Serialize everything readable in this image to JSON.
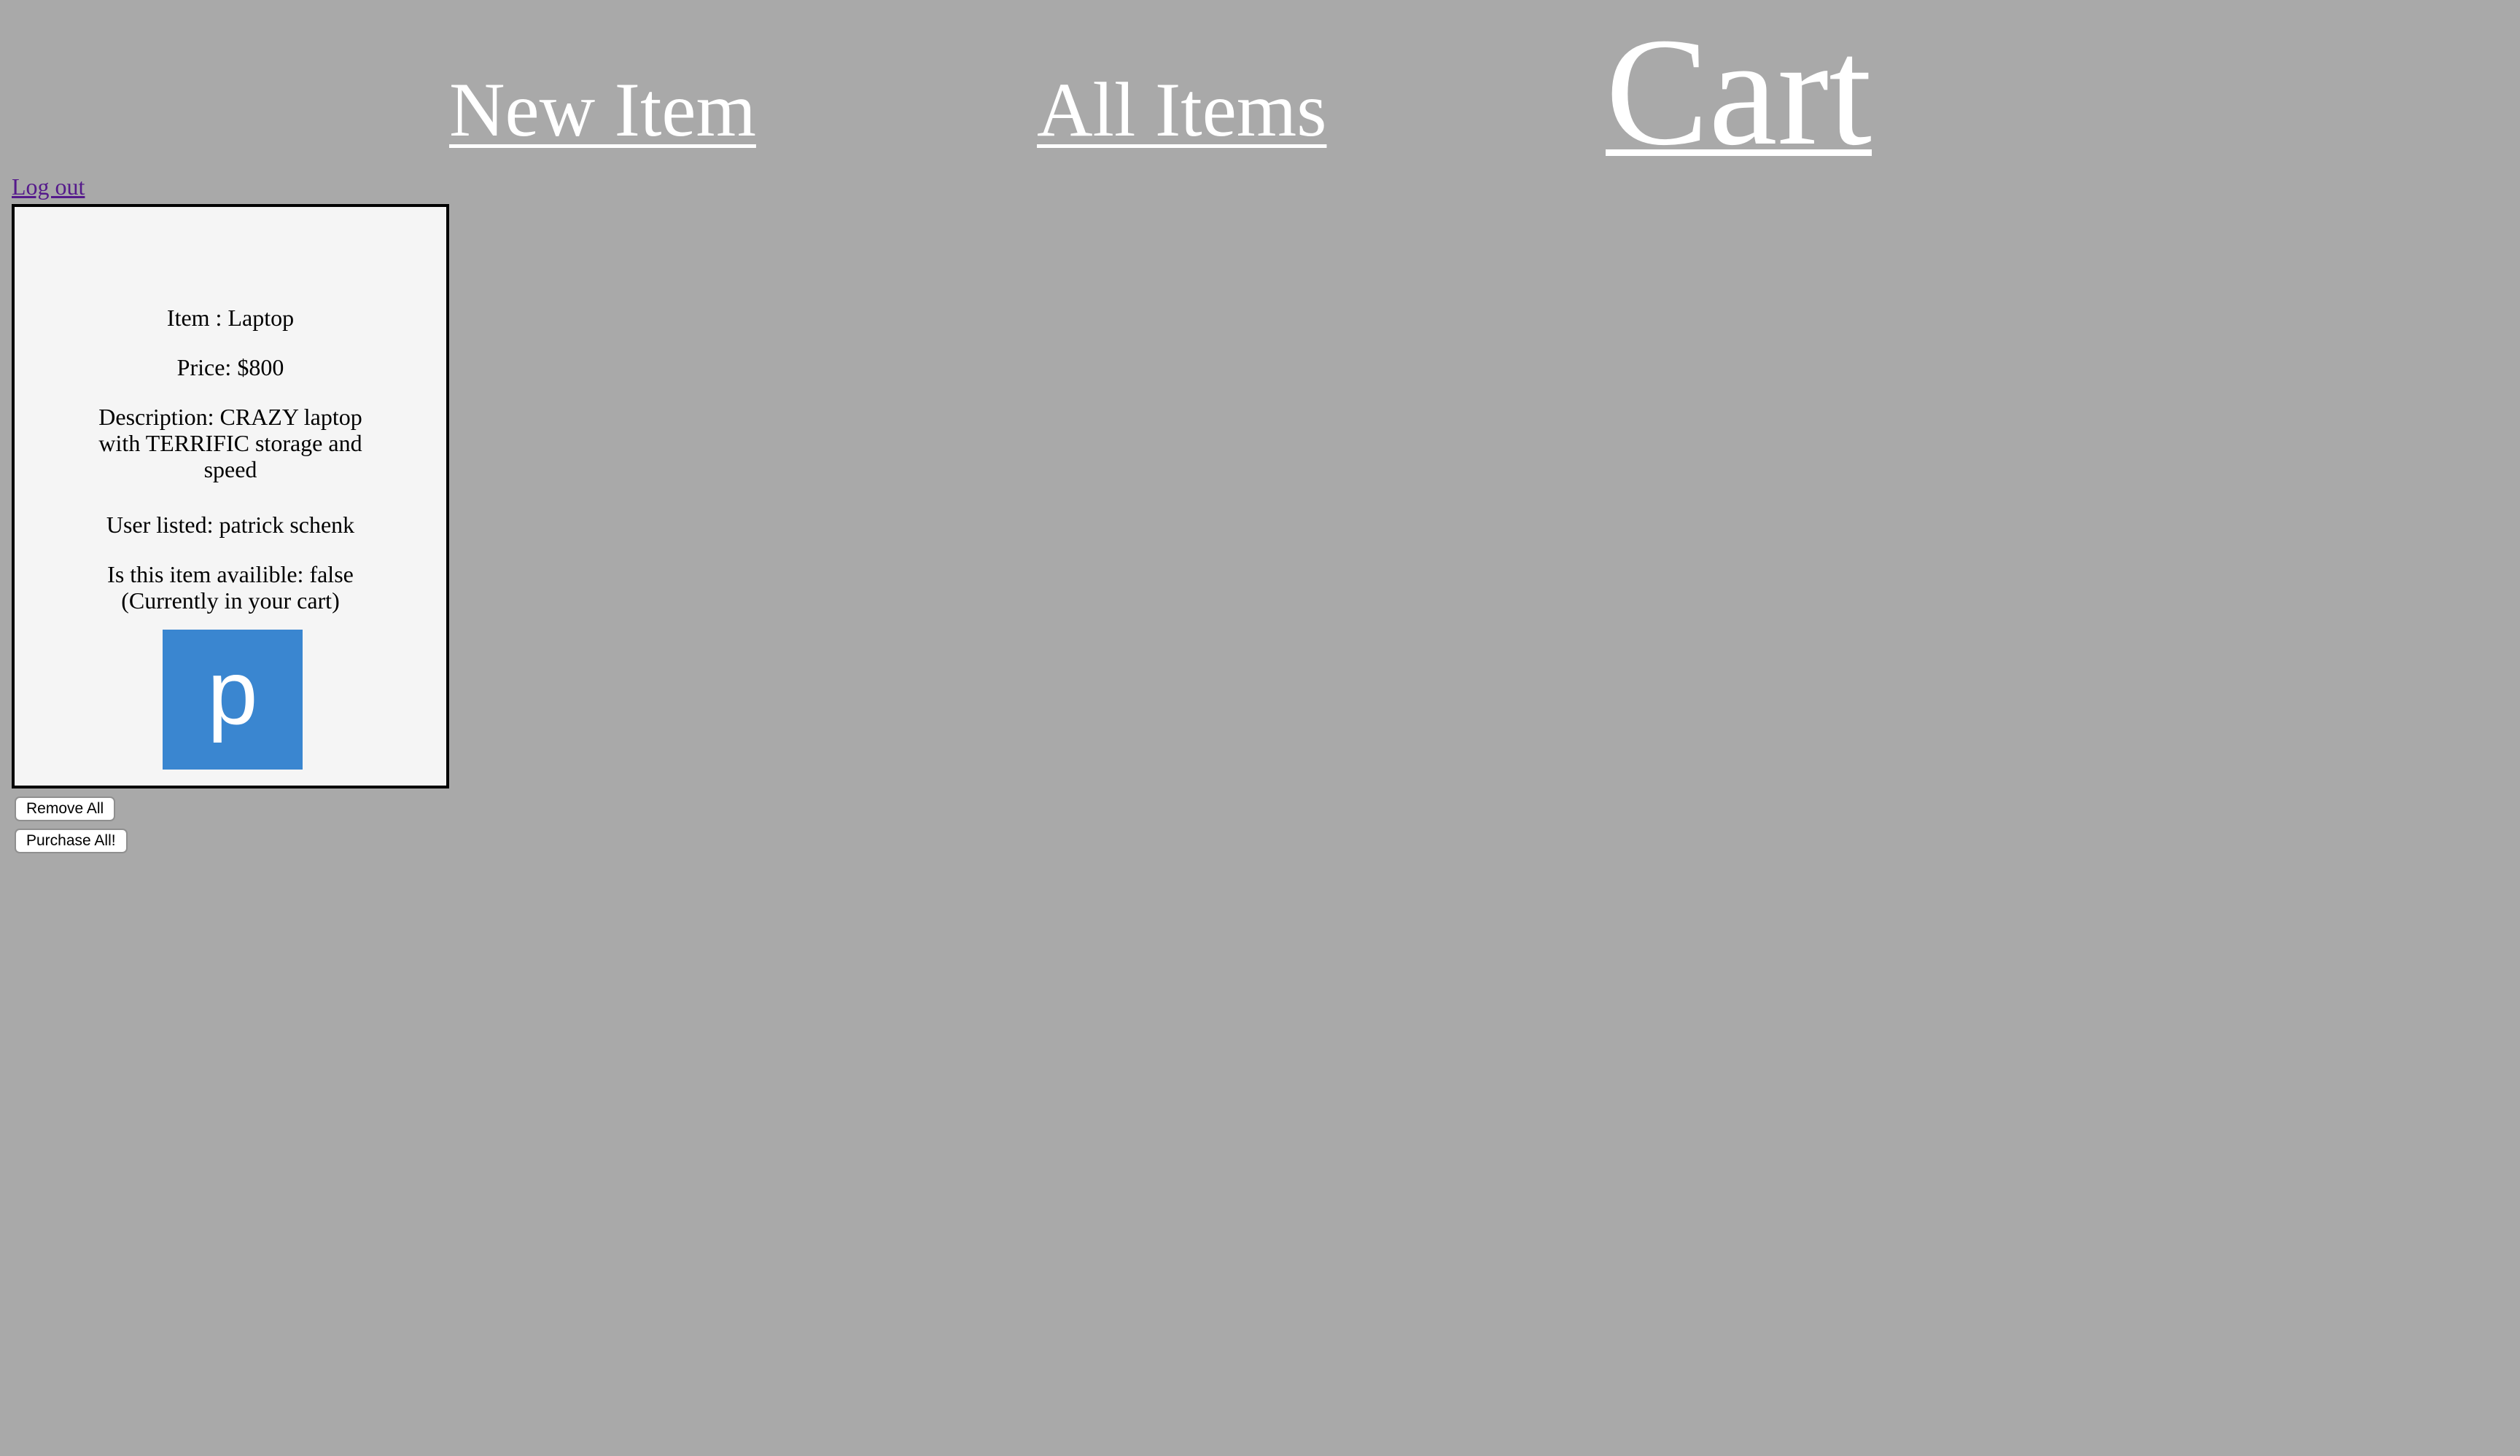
{
  "nav": {
    "new_item": "New Item",
    "all_items": "All Items",
    "cart": "Cart"
  },
  "logout_label": "Log out",
  "cart_items": [
    {
      "item": "Item : Laptop",
      "price": "Price: $800",
      "description": "Description: CRAZY laptop with TERRIFIC storage and speed",
      "user_listed": "User listed: patrick schenk",
      "availability": "Is this item availible: false (Currently in your cart)",
      "avatar_letter": "p",
      "avatar_color": "#3a86d0"
    }
  ],
  "actions": {
    "remove_all": "Remove All",
    "purchase_all": "Purchase All!"
  },
  "colors": {
    "background": "#a9a9a9",
    "card_background": "#f5f5f5",
    "nav_link": "#ffffff",
    "visited_link": "#551a8b"
  }
}
